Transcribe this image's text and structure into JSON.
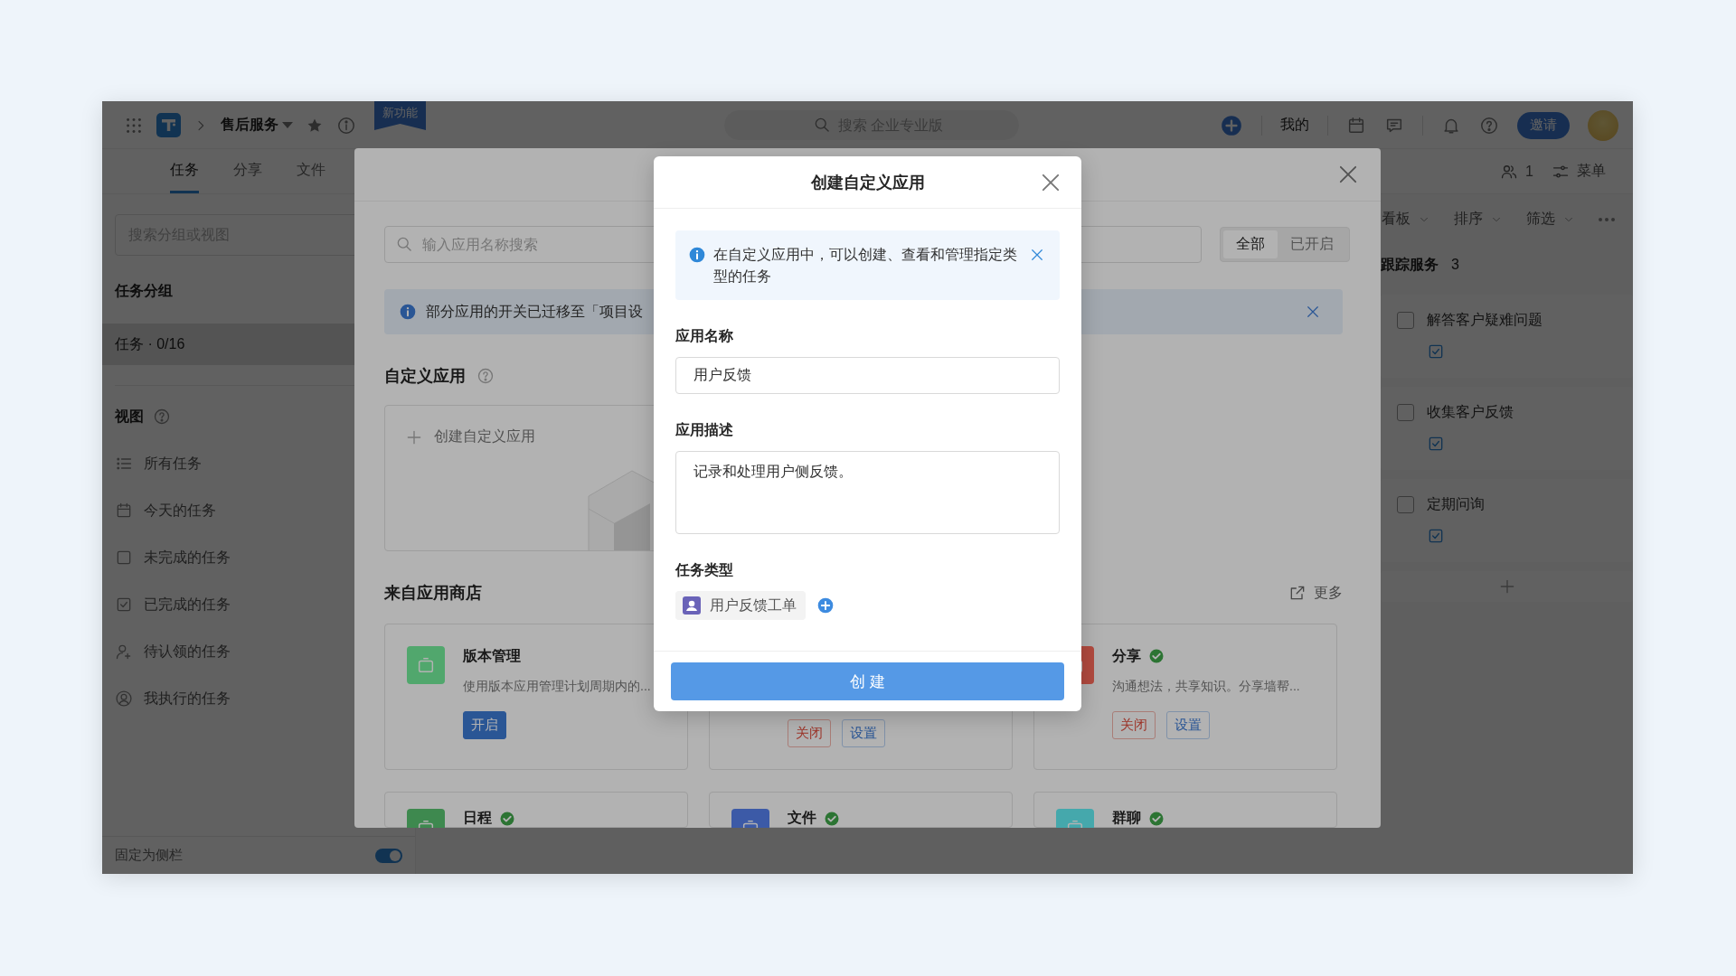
{
  "topbar": {
    "project": "售后服务",
    "badge": "新功能",
    "search_placeholder": "搜索 企业专业版",
    "mine": "我的",
    "invite": "邀请"
  },
  "tabs": [
    {
      "label": "任务",
      "selected": true
    },
    {
      "label": "分享",
      "selected": false
    },
    {
      "label": "文件",
      "selected": false
    }
  ],
  "header_actions": {
    "members": "1",
    "menu": "菜单"
  },
  "sidebar": {
    "search_placeholder": "搜索分组或视图",
    "groups_title": "任务分组",
    "groups": [
      {
        "label": "任务 · 0/16",
        "selected": true
      }
    ],
    "views_title": "视图",
    "views": [
      {
        "label": "所有任务",
        "kind": "list"
      },
      {
        "label": "今天的任务",
        "kind": "calendar"
      },
      {
        "label": "未完成的任务",
        "kind": "open"
      },
      {
        "label": "已完成的任务",
        "kind": "done"
      },
      {
        "label": "待认领的任务",
        "kind": "claim"
      },
      {
        "label": "我执行的任务",
        "kind": "mine"
      }
    ],
    "footer": {
      "label": "固定为侧栏",
      "on": true
    }
  },
  "board": {
    "toolbar": [
      "看板",
      "排序",
      "筛选"
    ],
    "column": {
      "title": "跟踪服务",
      "count": "3",
      "tasks": [
        {
          "title": "解答客户疑难问题",
          "checked": false
        },
        {
          "title": "收集客户反馈",
          "checked": false
        },
        {
          "title": "定期问询",
          "checked": false
        }
      ]
    }
  },
  "panel": {
    "search_placeholder": "输入应用名称搜索",
    "filters": [
      {
        "label": "全部",
        "selected": true
      },
      {
        "label": "已开启",
        "selected": false
      }
    ],
    "notice": "部分应用的开关已迁移至「项目设",
    "custom_title": "自定义应用",
    "create_label": "创建自定义应用",
    "store_title": "来自应用商店",
    "more": "更多",
    "apps": [
      {
        "name": "版本管理",
        "description": "使用版本应用管理计划周期内的...",
        "color": "#52a86e",
        "enabled": false,
        "buttons": [
          {
            "label": "开启",
            "kind": "primary"
          }
        ]
      },
      {
        "buttons": [
          {
            "label": "关闭",
            "kind": "danger"
          },
          {
            "label": "设置",
            "kind": "outline"
          }
        ]
      },
      {
        "name": "分享",
        "description": "沟通想法，共享知识。分享墙帮...",
        "color": "#b24a40",
        "enabled": true,
        "buttons": [
          {
            "label": "关闭",
            "kind": "danger"
          },
          {
            "label": "设置",
            "kind": "outline"
          }
        ]
      },
      {
        "name": "日程",
        "color": "#3f8a4f",
        "enabled": true
      },
      {
        "name": "文件",
        "color": "#3c5aa8",
        "enabled": true
      },
      {
        "name": "群聊",
        "color": "#45a9ad",
        "enabled": true
      }
    ]
  },
  "modal": {
    "title": "创建自定义应用",
    "info": "在自定义应用中，可以创建、查看和管理指定类型的任务",
    "fields": [
      {
        "label": "应用名称",
        "kind": "input",
        "value": "用户反馈"
      },
      {
        "label": "应用描述",
        "kind": "textarea",
        "value": "记录和处理用户侧反馈。"
      }
    ],
    "type_label": "任务类型",
    "type_tag": "用户反馈工单",
    "submit": "创 建"
  }
}
